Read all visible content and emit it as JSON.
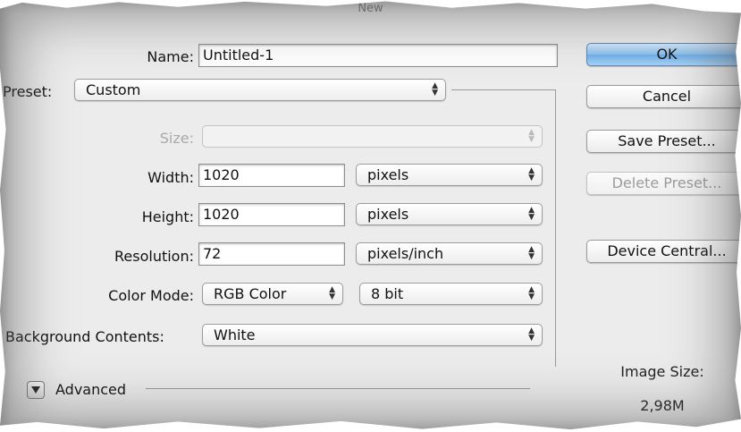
{
  "window": {
    "title": "New"
  },
  "form": {
    "name_label": "Name:",
    "name_value": "Untitled-1",
    "preset_label": "Preset:",
    "preset_value": "Custom",
    "size_label": "Size:",
    "size_value": "",
    "width_label": "Width:",
    "width_value": "1020",
    "width_unit": "pixels",
    "height_label": "Height:",
    "height_value": "1020",
    "height_unit": "pixels",
    "resolution_label": "Resolution:",
    "resolution_value": "72",
    "resolution_unit": "pixels/inch",
    "color_mode_label": "Color Mode:",
    "color_mode_value": "RGB Color",
    "bit_depth_value": "8 bit",
    "background_label": "Background Contents:",
    "background_value": "White",
    "advanced_label": "Advanced"
  },
  "buttons": {
    "ok": "OK",
    "cancel": "Cancel",
    "save_preset": "Save Preset...",
    "delete_preset": "Delete Preset...",
    "device_central": "Device Central..."
  },
  "image_size": {
    "label": "Image Size:",
    "value": "2,98M"
  },
  "icons": {
    "select_arrows": "updown-arrows-icon",
    "advanced_toggle": "disclosure-triangle-icon"
  }
}
